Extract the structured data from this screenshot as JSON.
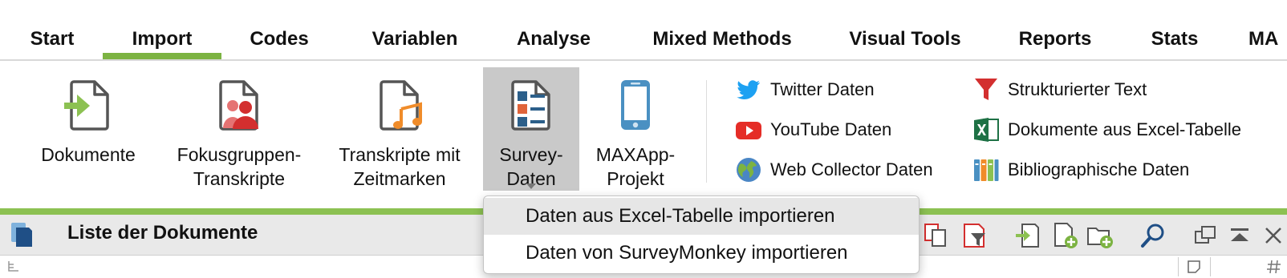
{
  "tabs": [
    {
      "label": "Start"
    },
    {
      "label": "Import",
      "active": true
    },
    {
      "label": "Codes"
    },
    {
      "label": "Variablen"
    },
    {
      "label": "Analyse"
    },
    {
      "label": "Mixed Methods"
    },
    {
      "label": "Visual Tools"
    },
    {
      "label": "Reports"
    },
    {
      "label": "Stats"
    },
    {
      "label": "MA"
    }
  ],
  "ribbon": {
    "buttons": [
      {
        "lines": [
          "Dokumente"
        ],
        "icon": "import-document-icon"
      },
      {
        "lines": [
          "Fokusgruppen-",
          "Transkripte"
        ],
        "icon": "focus-group-icon"
      },
      {
        "lines": [
          "Transkripte mit",
          "Zeitmarken"
        ],
        "icon": "timestamped-transcript-icon"
      },
      {
        "lines": [
          "Survey-",
          "Daten"
        ],
        "icon": "survey-data-icon",
        "selected": true
      },
      {
        "lines": [
          "MAXApp-",
          "Projekt"
        ],
        "icon": "smartphone-icon"
      }
    ],
    "small_items": [
      {
        "label": "Twitter Daten",
        "icon": "twitter-icon"
      },
      {
        "label": "YouTube Daten",
        "icon": "youtube-icon"
      },
      {
        "label": "Web Collector Daten",
        "icon": "globe-icon"
      },
      {
        "label": "Strukturierter Text",
        "icon": "structured-text-icon"
      },
      {
        "label": "Dokumente aus Excel-Tabelle",
        "icon": "excel-icon"
      },
      {
        "label": "Bibliographische Daten",
        "icon": "bibliography-icon"
      }
    ]
  },
  "document_list": {
    "title": "Liste der Dokumente"
  },
  "dropdown": {
    "items": [
      {
        "label": "Daten aus Excel-Tabelle importieren",
        "highlighted": true
      },
      {
        "label": "Daten von SurveyMonkey importieren"
      }
    ]
  },
  "colors": {
    "accent_green": "#7cb342",
    "ribbon_selected": "#c9c9c9",
    "twitter_blue": "#1da1f2",
    "youtube_red": "#e52d27",
    "excel_green": "#1e7145"
  }
}
